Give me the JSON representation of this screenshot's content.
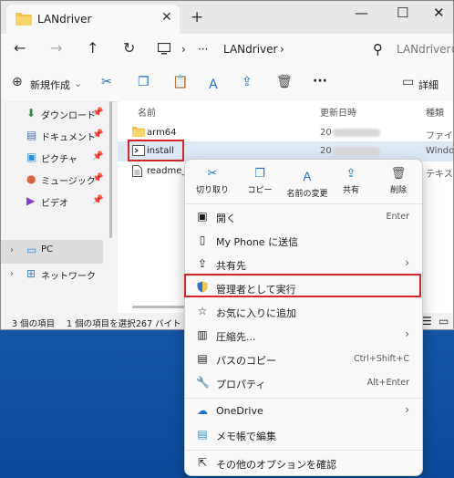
{
  "window": {
    "tab_title": "LANdriver",
    "tab_close": "✕",
    "new_tab": "+",
    "controls": {
      "minimize": "—",
      "maximize": "☐",
      "close": "✕"
    }
  },
  "navbar": {
    "back": "←",
    "forward": "→",
    "up": "↑",
    "refresh": "↻",
    "crumbs": [
      "›",
      "···",
      "LANdriver",
      "›"
    ],
    "search_placeholder": "LANdriverの"
  },
  "toolbar": {
    "new_label": "新規作成",
    "details_label": "詳細",
    "more": "···"
  },
  "sidebar": {
    "items": [
      {
        "label": "ダウンロード",
        "pin": "📌"
      },
      {
        "label": "ドキュメント",
        "pin": "📌"
      },
      {
        "label": "ピクチャ",
        "pin": "📌"
      },
      {
        "label": "ミュージック",
        "pin": "📌"
      },
      {
        "label": "ビデオ",
        "pin": "📌"
      },
      {
        "label": "PC",
        "pin": ""
      },
      {
        "label": "ネットワーク",
        "pin": ""
      }
    ]
  },
  "content": {
    "columns": [
      "名前",
      "更新日時",
      "種類"
    ],
    "files": [
      {
        "name": "arm64",
        "date": "20",
        "type": "ファイル",
        "icon": "folder-icon"
      },
      {
        "name": "install",
        "date": "20",
        "type": "Window",
        "icon": "script-icon"
      },
      {
        "name": "readme_jp",
        "date": "",
        "type": "テキスト",
        "icon": "text-file-icon"
      }
    ]
  },
  "statusbar": {
    "count": "3 個の項目",
    "selected": "1 個の項目を選択",
    "size": "267 バイト"
  },
  "context_menu": {
    "top_actions": [
      {
        "label": "切り取り",
        "icon": "scissors-icon"
      },
      {
        "label": "コピー",
        "icon": "copy-icon"
      },
      {
        "label": "名前の変更",
        "icon": "rename-icon"
      },
      {
        "label": "共有",
        "icon": "share-icon"
      },
      {
        "label": "削除",
        "icon": "trash-icon"
      }
    ],
    "items": [
      {
        "label": "開く",
        "shortcut": "Enter",
        "arrow": ""
      },
      {
        "label": "My Phone に送信",
        "shortcut": "",
        "arrow": ""
      },
      {
        "label": "共有先",
        "shortcut": "",
        "arrow": "›"
      },
      {
        "label": "管理者として実行",
        "shortcut": "",
        "arrow": ""
      },
      {
        "label": "お気に入りに追加",
        "shortcut": "",
        "arrow": ""
      },
      {
        "label": "圧縮先...",
        "shortcut": "",
        "arrow": "›"
      },
      {
        "label": "パスのコピー",
        "shortcut": "Ctrl+Shift+C",
        "arrow": ""
      },
      {
        "label": "プロパティ",
        "shortcut": "Alt+Enter",
        "arrow": ""
      },
      {
        "label": "OneDrive",
        "shortcut": "",
        "arrow": "›"
      },
      {
        "label": "メモ帳で編集",
        "shortcut": "",
        "arrow": ""
      },
      {
        "label": "その他のオプションを確認",
        "shortcut": "",
        "arrow": ""
      }
    ]
  },
  "colors": {
    "highlight_border": "#d9262b",
    "accent": "#1a6fd0"
  }
}
